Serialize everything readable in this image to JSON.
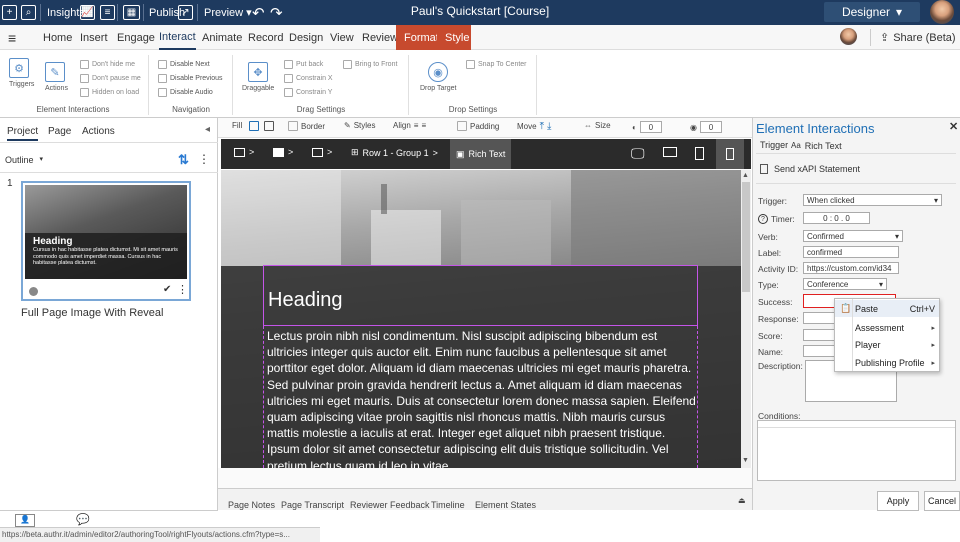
{
  "topbar": {
    "insights": "Insights",
    "publish": "Publish",
    "preview": "Preview",
    "title": "Paul's Quickstart [Course]",
    "role": "Designer"
  },
  "ribbon_tabs": [
    "Home",
    "Insert",
    "Engage",
    "Interact",
    "Animate",
    "Record",
    "Design",
    "View",
    "Review"
  ],
  "context_tabs": [
    "Format",
    "Style"
  ],
  "share": "Share (Beta)",
  "ribbon": {
    "triggers": "Triggers",
    "actions": "Actions",
    "dont_hide": "Don't hide me",
    "dont_pause": "Don't pause me",
    "hidden_load": "Hidden on load",
    "disable_next": "Disable Next",
    "disable_previous": "Disable Previous",
    "disable_audio": "Disable Audio",
    "draggable": "Draggable",
    "put_back": "Put back",
    "constrain_x": "Constrain X",
    "constrain_y": "Constrain Y",
    "bring_front": "Bring to Front",
    "drop_target": "Drop Target",
    "snap_center": "Snap To Center",
    "grp_element": "Element Interactions",
    "grp_navigation": "Navigation",
    "grp_drag": "Drag Settings",
    "grp_drop": "Drop Settings"
  },
  "left": {
    "tabs": [
      "Project",
      "Page",
      "Actions"
    ],
    "outline": "Outline",
    "page_number": "1",
    "thumb_heading": "Heading",
    "thumb_text": "Cursus in hac habitasse platea dictumst. Mi sit amet mauris commodo quis amet imperdiet massa. Cursus in hac habitasse platea dictumst.",
    "page_title": "Full Page Image With Reveal"
  },
  "canvas_toolbar": {
    "fill": "Fill",
    "border": "Border",
    "styles": "Styles",
    "align": "Align",
    "padding": "Padding",
    "move": "Move",
    "size": "Size",
    "opacity_value": "0",
    "rotate_value": "0"
  },
  "breadcrumb": {
    "row": "Row 1 - Group 1",
    "current": "Rich Text"
  },
  "content": {
    "heading": "Heading",
    "body": "Lectus proin nibh nisl condimentum. Nisl suscipit adipiscing bibendum est ultricies integer quis auctor elit. Enim nunc faucibus a pellentesque sit amet porttitor eget dolor. Aliquam id diam maecenas ultricies mi eget mauris pharetra. Sed pulvinar proin gravida hendrerit lectus a. Amet aliquam id diam maecenas ultricies mi eget mauris. Duis at consectetur lorem donec massa sapien. Eleifend quam adipiscing vitae proin sagittis nisl rhoncus mattis. Nibh mauris cursus mattis molestie a iaculis at erat. Integer eget aliquet nibh praesent tristique. Ipsum dolor sit amet consectetur adipiscing elit duis tristique sollicitudin. Vel pretium lectus quam id leo in vitae."
  },
  "bottom_tabs": [
    "Page Notes",
    "Page Transcript",
    "Reviewer Feedback",
    "Timeline",
    "Element States"
  ],
  "right": {
    "title": "Element Interactions",
    "trigger_tab": "Trigger",
    "rich_text_tab": "Rich Text",
    "action": "Send xAPI Statement",
    "trigger_label": "Trigger:",
    "trigger_value": "When clicked",
    "timer_label": "Timer:",
    "timer_value": "0 : 0 . 0",
    "verb_label": "Verb:",
    "verb_value": "Confirmed",
    "label_label": "Label:",
    "label_value": "confirmed",
    "activity_label": "Activity ID:",
    "activity_value": "https://custom.com/id34",
    "type_label": "Type:",
    "type_value": "Conference",
    "success_label": "Success:",
    "response_label": "Response:",
    "score_label": "Score:",
    "name_label": "Name:",
    "description_label": "Description:",
    "conditions_label": "Conditions:",
    "apply": "Apply",
    "cancel": "Cancel"
  },
  "context_menu": {
    "paste": "Paste",
    "paste_shortcut": "Ctrl+V",
    "assessment": "Assessment",
    "player": "Player",
    "publishing_profile": "Publishing Profile"
  },
  "status_url": "https://beta.authr.it/admin/editor2/authoringTool/rightFlyouts/actions.cfm?type=s..."
}
